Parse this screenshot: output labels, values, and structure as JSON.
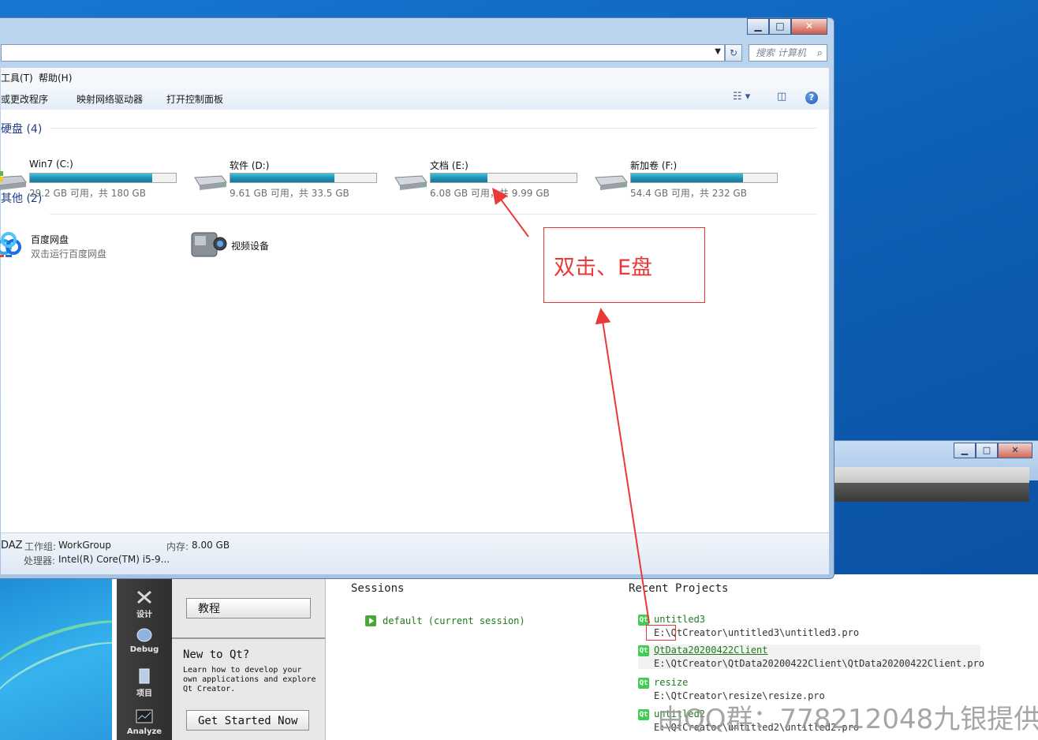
{
  "explorer": {
    "search_placeholder": "搜索 计算机",
    "menu": {
      "tools": "工具(T)",
      "help": "帮助(H)"
    },
    "toolbar": {
      "change_program": "或更改程序",
      "map_drive": "映射网络驱动器",
      "control_panel": "打开控制面板"
    },
    "groups": {
      "hdd": "硬盘 (4)",
      "other": "其他 (2)"
    },
    "drives": [
      {
        "name": "Win7 (C:)",
        "info": "29.2 GB 可用，共 180 GB",
        "free_gb": 29.2,
        "total_gb": 180
      },
      {
        "name": "软件 (D:)",
        "info": "9.61 GB 可用，共 33.5 GB",
        "free_gb": 9.61,
        "total_gb": 33.5
      },
      {
        "name": "文档 (E:)",
        "info": "6.08 GB 可用，共 9.99 GB",
        "free_gb": 6.08,
        "total_gb": 9.99
      },
      {
        "name": "新加卷 (F:)",
        "info": "54.4 GB 可用，共 232 GB",
        "free_gb": 54.4,
        "total_gb": 232
      }
    ],
    "others": [
      {
        "name": "百度网盘",
        "sub": "双击运行百度网盘"
      },
      {
        "name": "视频设备",
        "sub": ""
      }
    ],
    "details": {
      "pc_suffix": "DAZ",
      "workgroup_label": "工作组:",
      "workgroup_value": "WorkGroup",
      "memory_label": "内存:",
      "memory_value": "8.00 GB",
      "cpu_label": "处理器:",
      "cpu_value": "Intel(R) Core(TM) i5-9..."
    }
  },
  "annotation": {
    "text": "双击、E盘"
  },
  "qt": {
    "modes": {
      "design": "设计",
      "debug": "Debug",
      "projects": "项目",
      "analyze": "Analyze"
    },
    "side": {
      "tutorials": "教程",
      "new_title": "New to Qt?",
      "new_text": "Learn how to develop your own applications and explore Qt Creator.",
      "get_started": "Get Started Now"
    },
    "sessions_title": "Sessions",
    "session_default": "default (current session)",
    "recent_title": "Recent Projects",
    "projects": [
      {
        "name": "untitled3",
        "path": "E:\\QtCreator\\untitled3\\untitled3.pro"
      },
      {
        "name": "QtData20200422Client",
        "path": "E:\\QtCreator\\QtData20200422Client\\QtData20200422Client.pro"
      },
      {
        "name": "resize",
        "path": "E:\\QtCreator\\resize\\resize.pro"
      },
      {
        "name": "untitled2",
        "path": "E:\\QtCreator\\untitled2\\untitled2.pro"
      }
    ]
  },
  "watermark": "由QQ群：778212048九银提供",
  "colors": {
    "annotation": "#e83a3a",
    "qt_green": "#41cd52",
    "drive_fill": "#1f8fb3"
  }
}
